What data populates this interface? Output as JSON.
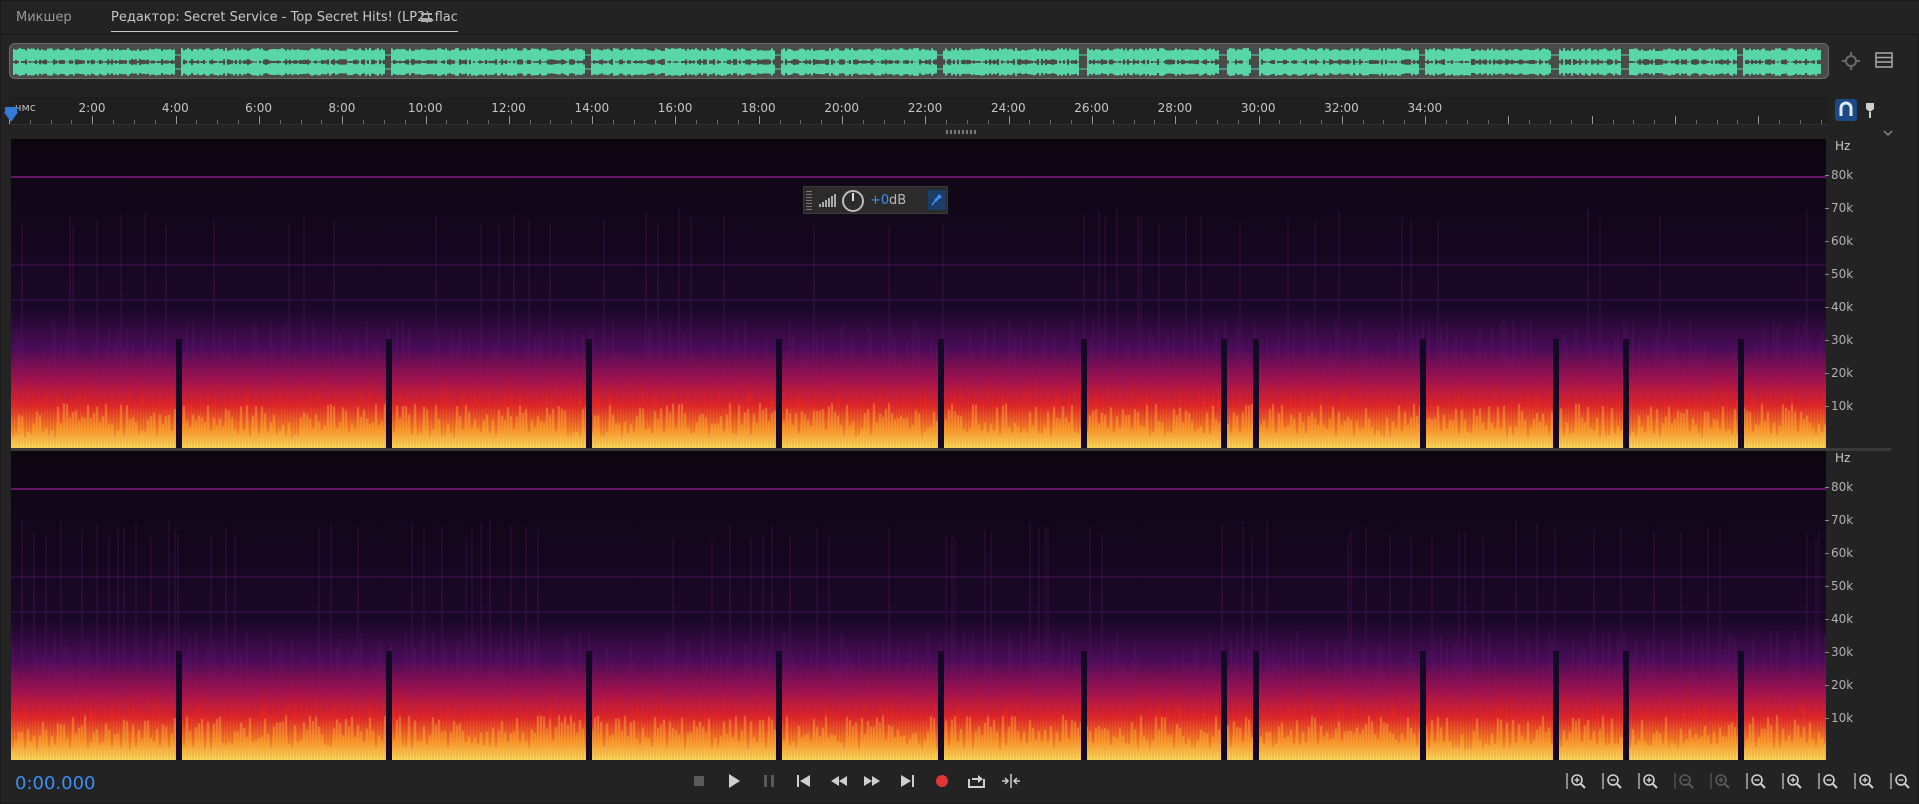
{
  "tabs": {
    "mixer": "Микшер",
    "editor": "Редактор: Secret Service - Top Secret Hits! (LP2).flac",
    "menu_icon": "hamburger-menu-icon"
  },
  "ruler": {
    "unit": "чмс",
    "labels": [
      "2:00",
      "4:00",
      "6:00",
      "8:00",
      "10:00",
      "12:00",
      "14:00",
      "16:00",
      "18:00",
      "20:00",
      "22:00",
      "24:00",
      "26:00",
      "28:00",
      "30:00",
      "32:00",
      "34:00"
    ]
  },
  "hud": {
    "value": "+0",
    "unit": "dB"
  },
  "frequency_axis": {
    "title": "Hz",
    "labels": [
      "80k",
      "70k",
      "60k",
      "50k",
      "40k",
      "30k",
      "20k",
      "10k"
    ]
  },
  "transport": {
    "time": "0:00.000",
    "buttons": [
      "stop-icon",
      "play-icon",
      "pause-icon",
      "go-to-start-icon",
      "rewind-icon",
      "fast-forward-icon",
      "go-to-end-icon",
      "record-icon",
      "loop-playback-icon",
      "skip-selection-icon"
    ]
  },
  "zoom_buttons": [
    "zoom-in-amplitude-icon",
    "zoom-out-amplitude-icon",
    "zoom-in-time-icon",
    "zoom-out-time-icon",
    "zoom-out-full-icon",
    "zoom-in-point-in-icon",
    "zoom-in-point-out-icon",
    "zoom-selection-icon",
    "zoom-reset-icon",
    "zoom-full-icon"
  ],
  "colors": {
    "accent": "#3d8ef0",
    "waveform": "#58d6a8",
    "spectrum_low": "#1a0620",
    "spectrum_hot": "#ffd24a"
  }
}
